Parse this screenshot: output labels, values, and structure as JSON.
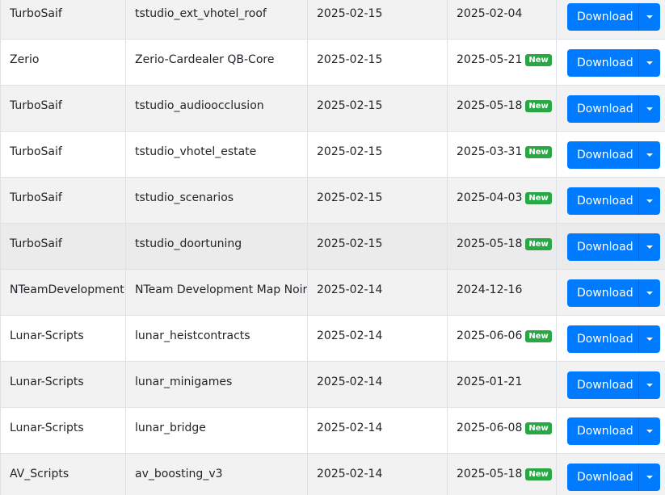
{
  "table": {
    "download_label": "Download",
    "new_badge_label": "New",
    "rows": [
      {
        "author": "TurboSaif",
        "name": "tstudio_ext_vhotel_roof",
        "added": "2025-02-15",
        "updated": "2025-02-04",
        "is_new": false
      },
      {
        "author": "Zerio",
        "name": "Zerio-Cardealer QB-Core",
        "added": "2025-02-15",
        "updated": "2025-05-21",
        "is_new": true
      },
      {
        "author": "TurboSaif",
        "name": "tstudio_audioocclusion",
        "added": "2025-02-15",
        "updated": "2025-05-18",
        "is_new": true
      },
      {
        "author": "TurboSaif",
        "name": "tstudio_vhotel_estate",
        "added": "2025-02-15",
        "updated": "2025-03-31",
        "is_new": true
      },
      {
        "author": "TurboSaif",
        "name": "tstudio_scenarios",
        "added": "2025-02-15",
        "updated": "2025-04-03",
        "is_new": true
      },
      {
        "author": "TurboSaif",
        "name": "tstudio_doortuning",
        "added": "2025-02-15",
        "updated": "2025-05-18",
        "is_new": true
      },
      {
        "author": "NTeamDevelopment",
        "name": "NTeam Development Map Noir",
        "added": "2025-02-14",
        "updated": "2024-12-16",
        "is_new": false
      },
      {
        "author": "Lunar-Scripts",
        "name": "lunar_heistcontracts",
        "added": "2025-02-14",
        "updated": "2025-06-06",
        "is_new": true
      },
      {
        "author": "Lunar-Scripts",
        "name": "lunar_minigames",
        "added": "2025-02-14",
        "updated": "2025-01-21",
        "is_new": false
      },
      {
        "author": "Lunar-Scripts",
        "name": "lunar_bridge",
        "added": "2025-02-14",
        "updated": "2025-06-08",
        "is_new": true
      },
      {
        "author": "AV_Scripts",
        "name": "av_boosting_v3",
        "added": "2025-02-14",
        "updated": "2025-05-18",
        "is_new": true
      }
    ]
  },
  "colors": {
    "primary_button": "#007bff",
    "new_badge": "#28a745",
    "stripe": "#f2f2f2",
    "hover_row": "#ebebeb"
  },
  "icons": {
    "dropdown": "caret-down-icon"
  }
}
